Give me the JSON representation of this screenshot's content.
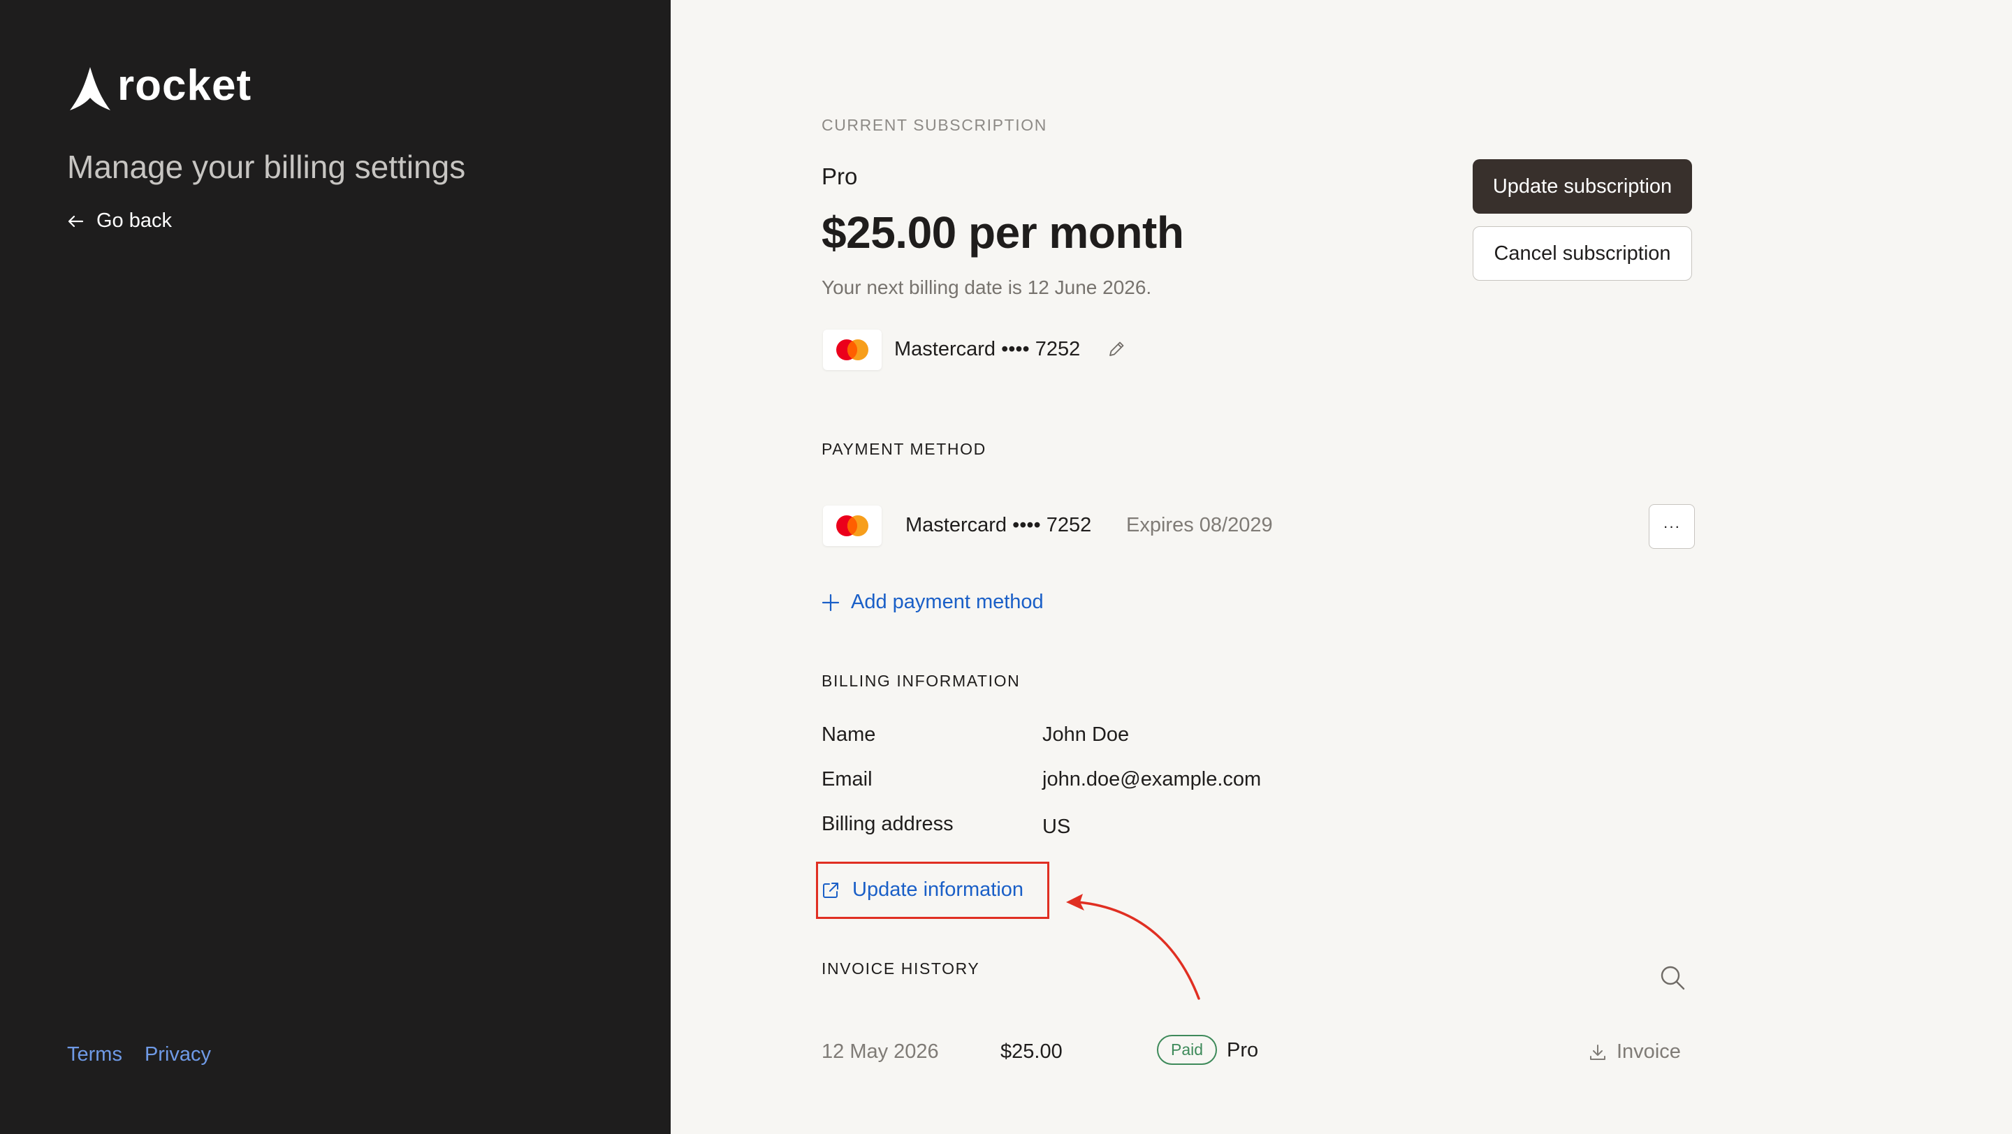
{
  "sidebar": {
    "brand": "rocket",
    "heading": "Manage your billing settings",
    "go_back": "Go back",
    "footer_links": {
      "terms": "Terms",
      "privacy": "Privacy"
    }
  },
  "subscription": {
    "section_label": "CURRENT SUBSCRIPTION",
    "plan": "Pro",
    "price": "$25.00 per month",
    "next_billing": "Your next billing date is 12 June 2026.",
    "card": "Mastercard •••• 7252",
    "update_button": "Update subscription",
    "cancel_button": "Cancel subscription"
  },
  "payment_method": {
    "section_label": "PAYMENT METHOD",
    "card": "Mastercard •••• 7252",
    "expires": "Expires 08/2029",
    "more_button": "···",
    "add_link": "Add payment method"
  },
  "billing_info": {
    "section_label": "BILLING INFORMATION",
    "rows": [
      {
        "key": "Name",
        "value": "John Doe"
      },
      {
        "key": "Email",
        "value": "john.doe@example.com"
      },
      {
        "key": "Billing address",
        "value": "US"
      }
    ],
    "update_link": "Update information"
  },
  "invoice_history": {
    "section_label": "INVOICE HISTORY",
    "invoices": [
      {
        "date": "12 May 2026",
        "amount": "$25.00",
        "status": "Paid",
        "plan": "Pro",
        "download_label": "Invoice"
      }
    ]
  },
  "colors": {
    "sidebar_bg": "#1e1d1d",
    "main_bg": "#f7f6f3",
    "primary_button": "#38302c",
    "link_blue": "#1a5fc7",
    "highlight_red": "#e02f22",
    "paid_green": "#3e8a5a",
    "mastercard_red": "#eb001b",
    "mastercard_orange": "#f79e1b"
  },
  "icons": [
    "rocket-logo-icon",
    "arrow-left-icon",
    "mastercard-icon",
    "pencil-icon",
    "plus-icon",
    "external-link-icon",
    "search-icon",
    "download-icon",
    "annotation-arrow"
  ]
}
